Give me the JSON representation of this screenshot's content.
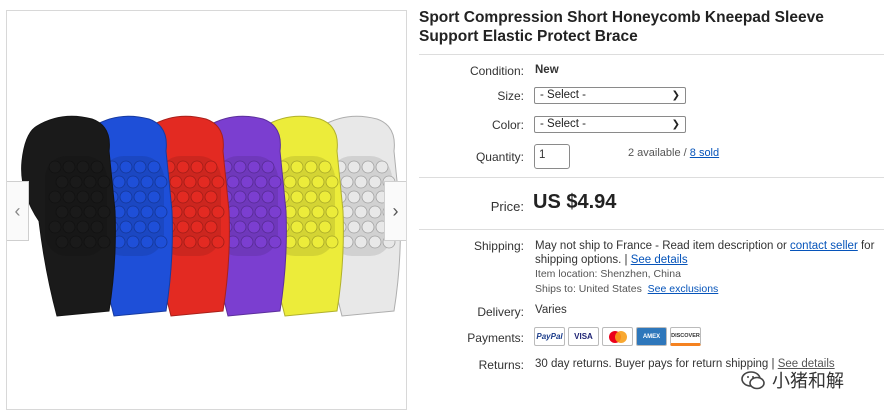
{
  "title": "Sport Compression Short Honeycomb Kneepad Sleeve Support Elastic Protect Brace",
  "gallery": {
    "prev": "‹",
    "next": "›",
    "sleeve_colors": [
      "#1a1a1a",
      "#1e4fd8",
      "#e32a22",
      "#7b3ed0",
      "#ecec3a",
      "#e8e8e8"
    ]
  },
  "condition": {
    "label": "Condition:",
    "value": "New"
  },
  "size": {
    "label": "Size:",
    "value": "- Select -"
  },
  "color": {
    "label": "Color:",
    "value": "- Select -"
  },
  "quantity": {
    "label": "Quantity:",
    "value": "1",
    "available": "2 available / ",
    "sold": "8 sold"
  },
  "price": {
    "label": "Price:",
    "value": "US $4.94"
  },
  "shipping": {
    "label": "Shipping:",
    "line1": "May not ship to France - Read item description or ",
    "contact_link": "contact seller",
    "line1_end": " for",
    "line2": "shipping options. | ",
    "details_link": "See details",
    "location_label": "Item location:",
    "location": "Shenzhen, China",
    "ships_label": "Ships to:",
    "ships_to": "United States",
    "exclusions_link": "See exclusions"
  },
  "delivery": {
    "label": "Delivery:",
    "value": "Varies"
  },
  "payments": {
    "label": "Payments:",
    "methods": [
      "PayPal",
      "VISA",
      "MasterCard",
      "AMEX",
      "DISCOVER"
    ]
  },
  "returns": {
    "label": "Returns:",
    "value": "30 day returns. Buyer pays for return shipping |",
    "link": "See details"
  },
  "watermark": "小猪和解"
}
